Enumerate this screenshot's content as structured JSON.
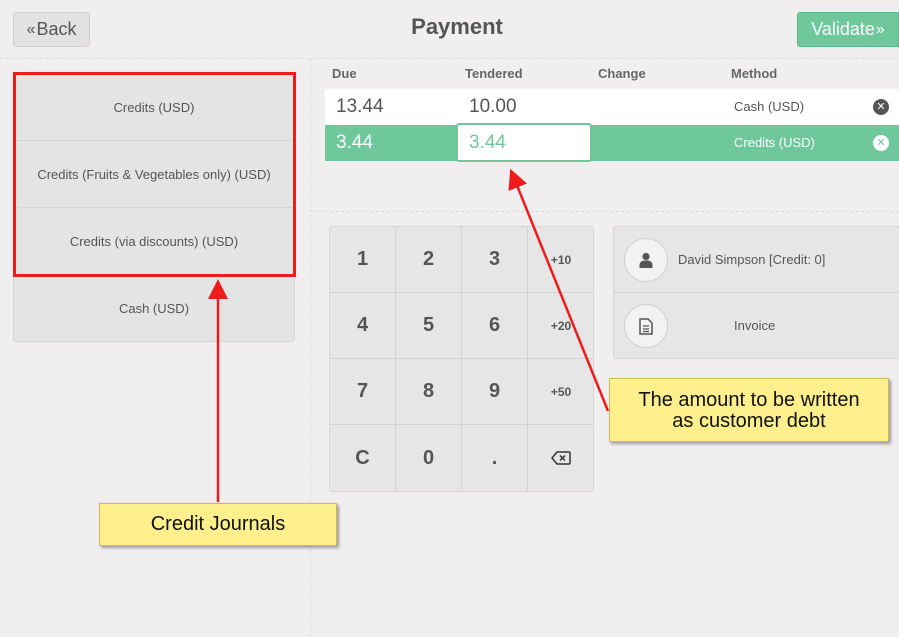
{
  "header": {
    "back_label": "Back",
    "back_icon": "double-chevron-left-icon",
    "title": "Payment",
    "validate_label": "Validate",
    "validate_icon": "double-chevron-right-icon"
  },
  "payment_methods": [
    {
      "label": "Credits (USD)"
    },
    {
      "label": "Credits (Fruits & Vegetables only) (USD)"
    },
    {
      "label": "Credits (via discounts) (USD)"
    },
    {
      "label": "Cash (USD)"
    }
  ],
  "paymentlines": {
    "columns": {
      "due": "Due",
      "tendered": "Tendered",
      "change": "Change",
      "method": "Method"
    },
    "rows": [
      {
        "due": "13.44",
        "tendered": "10.00",
        "change": "",
        "method": "Cash (USD)",
        "selected": false
      },
      {
        "due": "3.44",
        "tendered": "3.44",
        "change": "",
        "method": "Credits (USD)",
        "selected": true
      }
    ],
    "delete_icon": "remove-circle-icon"
  },
  "numpad": {
    "keys": [
      [
        "1",
        "2",
        "3",
        "+10"
      ],
      [
        "4",
        "5",
        "6",
        "+20"
      ],
      [
        "7",
        "8",
        "9",
        "+50"
      ],
      [
        "C",
        "0",
        ".",
        "⌫"
      ]
    ]
  },
  "customer": {
    "label": "David Simpson [Credit: 0]",
    "icon": "user-icon"
  },
  "invoice": {
    "label": "Invoice",
    "icon": "document-icon"
  },
  "annotations": {
    "debt_note_line1": "The amount to be written",
    "debt_note_line2": "as customer debt",
    "journals_note": "Credit Journals",
    "arrow_color": "#ee1c1c",
    "callout_color": "#fdef8c"
  },
  "colors": {
    "accent": "#6ec89b",
    "background": "#f0eeee",
    "text": "#555555"
  }
}
